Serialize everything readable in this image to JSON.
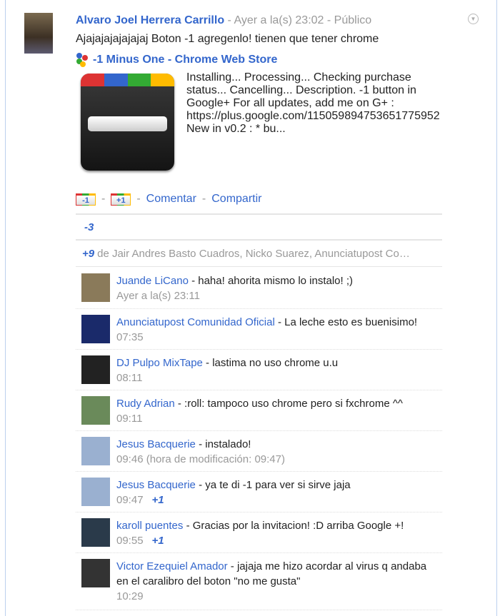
{
  "post": {
    "author": "Alvaro Joel Herrera Carrillo",
    "time": "Ayer a la(s) 23:02",
    "visibility": "Público",
    "dash": "-",
    "text": "Ajajajajajajajaj Boton -1 agregenlo! tienen que tener chrome",
    "link_title": "-1 Minus One - Chrome Web Store",
    "link_desc": "Installing... Processing... Checking purchase status... Cancelling... Description. -1 button in Google+ For all updates, add me on G+ : https://plus.google.com/115059894753651775952 New in v0.2 : * bu..."
  },
  "actions": {
    "minus_one": "-1",
    "plus_one": "+1",
    "comment": "Comentar",
    "share": "Compartir",
    "dash": "-"
  },
  "minus_count": "-3",
  "plus_count": "+9",
  "plus_by": "de Jair Andres Basto Cuadros, Nicko Suarez, Anunciatupost Co…",
  "comments": [
    {
      "author": "Juande LiCano",
      "text": " - haha! ahorita mismo lo instalo! ;)",
      "time": "Ayer a la(s) 23:11",
      "plus": "",
      "color": "#8a7a5a"
    },
    {
      "author": "Anunciatupost Comunidad Oficial",
      "text": " - La leche esto es buenisimo!",
      "time": "07:35",
      "plus": "",
      "color": "#1a2a6a"
    },
    {
      "author": "DJ Pulpo MixTape",
      "text": " - lastima no uso chrome u.u",
      "time": "08:11",
      "plus": "",
      "color": "#222"
    },
    {
      "author": "Rudy Adrian",
      "text": " - :roll: tampoco uso chrome pero si fxchrome ^^",
      "time": "09:11",
      "plus": "",
      "color": "#6a8a5a"
    },
    {
      "author": "Jesus Bacquerie",
      "text": " - instalado!",
      "time": "09:46 (hora de modificación: 09:47)",
      "plus": "",
      "color": "#9ab0d0"
    },
    {
      "author": "Jesus Bacquerie",
      "text": " - ya te di -1 para ver si sirve jaja",
      "time": "09:47",
      "plus": "+1",
      "color": "#9ab0d0"
    },
    {
      "author": "karoll puentes",
      "text": " - Gracias por la invitacion! :D arriba Google +!",
      "time": "09:55",
      "plus": "+1",
      "color": "#2a3a4a"
    },
    {
      "author": "Victor Ezequiel Amador",
      "text": " - jajaja me hizo acordar al virus q andaba en el caralibro del boton \"no me gusta\"",
      "time": "10:29",
      "plus": "",
      "color": "#333"
    }
  ]
}
